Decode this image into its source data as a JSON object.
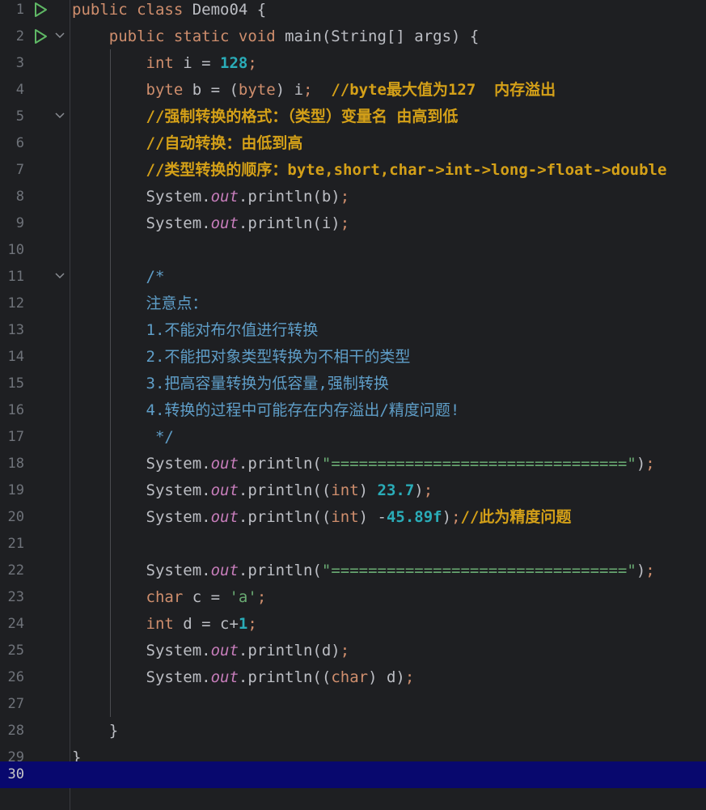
{
  "editor": {
    "language": "java",
    "theme_colors": {
      "background": "#1e1f22",
      "current_line": "#08086e",
      "keyword": "#cf8e6d",
      "number": "#2aacb8",
      "static_field": "#c77dbb",
      "string": "#6aab73",
      "comment": "#d4a018",
      "doc_comment": "#5f9ec8",
      "text": "#bcbec4"
    },
    "current_line": 30,
    "lines": [
      {
        "n": "1",
        "run": true,
        "fold": false,
        "tokens": [
          [
            "kw",
            "public class "
          ],
          [
            "plain",
            "Demo04 {"
          ]
        ]
      },
      {
        "n": "2",
        "run": true,
        "fold": true,
        "tokens": [
          [
            "plain",
            "    "
          ],
          [
            "kw",
            "public static void "
          ],
          [
            "plain",
            "main(String[] args) {"
          ]
        ]
      },
      {
        "n": "3",
        "tokens": [
          [
            "plain",
            "        "
          ],
          [
            "kw",
            "int "
          ],
          [
            "plain",
            "i = "
          ],
          [
            "num",
            "128"
          ],
          [
            "kw",
            ";"
          ]
        ]
      },
      {
        "n": "4",
        "tokens": [
          [
            "plain",
            "        "
          ],
          [
            "kw",
            "byte "
          ],
          [
            "plain",
            "b = ("
          ],
          [
            "kw",
            "byte"
          ],
          [
            "plain",
            ") i"
          ],
          [
            "kw",
            ";  "
          ],
          [
            "cmt",
            "//byte最大值为127  内存溢出"
          ]
        ]
      },
      {
        "n": "5",
        "fold": true,
        "tokens": [
          [
            "plain",
            "        "
          ],
          [
            "cmt",
            "//强制转换的格式：（类型）变量名 由高到低"
          ]
        ]
      },
      {
        "n": "6",
        "tokens": [
          [
            "plain",
            "        "
          ],
          [
            "cmt",
            "//自动转换：由低到高"
          ]
        ]
      },
      {
        "n": "7",
        "tokens": [
          [
            "plain",
            "        "
          ],
          [
            "cmt",
            "//类型转换的顺序：byte,short,char->int->long->float->double"
          ]
        ]
      },
      {
        "n": "8",
        "tokens": [
          [
            "plain",
            "        System."
          ],
          [
            "fld",
            "out"
          ],
          [
            "plain",
            ".println(b)"
          ],
          [
            "kw",
            ";"
          ]
        ]
      },
      {
        "n": "9",
        "tokens": [
          [
            "plain",
            "        System."
          ],
          [
            "fld",
            "out"
          ],
          [
            "plain",
            ".println(i)"
          ],
          [
            "kw",
            ";"
          ]
        ]
      },
      {
        "n": "10",
        "tokens": []
      },
      {
        "n": "11",
        "fold": true,
        "tokens": [
          [
            "plain",
            "        "
          ],
          [
            "doc",
            "/*"
          ]
        ]
      },
      {
        "n": "12",
        "tokens": [
          [
            "plain",
            "        "
          ],
          [
            "doc",
            "注意点："
          ]
        ]
      },
      {
        "n": "13",
        "tokens": [
          [
            "plain",
            "        "
          ],
          [
            "doc",
            "1.不能对布尔值进行转换"
          ]
        ]
      },
      {
        "n": "14",
        "tokens": [
          [
            "plain",
            "        "
          ],
          [
            "doc",
            "2.不能把对象类型转换为不相干的类型"
          ]
        ]
      },
      {
        "n": "15",
        "tokens": [
          [
            "plain",
            "        "
          ],
          [
            "doc",
            "3.把高容量转换为低容量,强制转换"
          ]
        ]
      },
      {
        "n": "16",
        "tokens": [
          [
            "plain",
            "        "
          ],
          [
            "doc",
            "4.转换的过程中可能存在内存溢出/精度问题!"
          ]
        ]
      },
      {
        "n": "17",
        "tokens": [
          [
            "plain",
            "         "
          ],
          [
            "doc",
            "*/"
          ]
        ]
      },
      {
        "n": "18",
        "tokens": [
          [
            "plain",
            "        System."
          ],
          [
            "fld",
            "out"
          ],
          [
            "plain",
            ".println("
          ],
          [
            "str",
            "\"================================\""
          ],
          [
            "plain",
            ")"
          ],
          [
            "kw",
            ";"
          ]
        ]
      },
      {
        "n": "19",
        "tokens": [
          [
            "plain",
            "        System."
          ],
          [
            "fld",
            "out"
          ],
          [
            "plain",
            ".println(("
          ],
          [
            "kw",
            "int"
          ],
          [
            "plain",
            ") "
          ],
          [
            "num",
            "23.7"
          ],
          [
            "plain",
            ")"
          ],
          [
            "kw",
            ";"
          ]
        ]
      },
      {
        "n": "20",
        "tokens": [
          [
            "plain",
            "        System."
          ],
          [
            "fld",
            "out"
          ],
          [
            "plain",
            ".println(("
          ],
          [
            "kw",
            "int"
          ],
          [
            "plain",
            ") -"
          ],
          [
            "num",
            "45.89f"
          ],
          [
            "plain",
            ")"
          ],
          [
            "kw",
            ";"
          ],
          [
            "cmt",
            "//此为精度问题"
          ]
        ]
      },
      {
        "n": "21",
        "tokens": []
      },
      {
        "n": "22",
        "tokens": [
          [
            "plain",
            "        System."
          ],
          [
            "fld",
            "out"
          ],
          [
            "plain",
            ".println("
          ],
          [
            "str",
            "\"================================\""
          ],
          [
            "plain",
            ")"
          ],
          [
            "kw",
            ";"
          ]
        ]
      },
      {
        "n": "23",
        "tokens": [
          [
            "plain",
            "        "
          ],
          [
            "kw",
            "char "
          ],
          [
            "plain",
            "c = "
          ],
          [
            "str",
            "'a'"
          ],
          [
            "kw",
            ";"
          ]
        ]
      },
      {
        "n": "24",
        "tokens": [
          [
            "plain",
            "        "
          ],
          [
            "kw",
            "int "
          ],
          [
            "plain",
            "d = c+"
          ],
          [
            "num",
            "1"
          ],
          [
            "kw",
            ";"
          ]
        ]
      },
      {
        "n": "25",
        "tokens": [
          [
            "plain",
            "        System."
          ],
          [
            "fld",
            "out"
          ],
          [
            "plain",
            ".println(d)"
          ],
          [
            "kw",
            ";"
          ]
        ]
      },
      {
        "n": "26",
        "tokens": [
          [
            "plain",
            "        System."
          ],
          [
            "fld",
            "out"
          ],
          [
            "plain",
            ".println(("
          ],
          [
            "kw",
            "char"
          ],
          [
            "plain",
            ") d)"
          ],
          [
            "kw",
            ";"
          ]
        ]
      },
      {
        "n": "27",
        "tokens": []
      },
      {
        "n": "28",
        "tokens": [
          [
            "plain",
            "    }"
          ]
        ]
      },
      {
        "n": "29",
        "tokens": [
          [
            "plain",
            "}"
          ]
        ]
      },
      {
        "n": "30",
        "tokens": []
      }
    ]
  }
}
